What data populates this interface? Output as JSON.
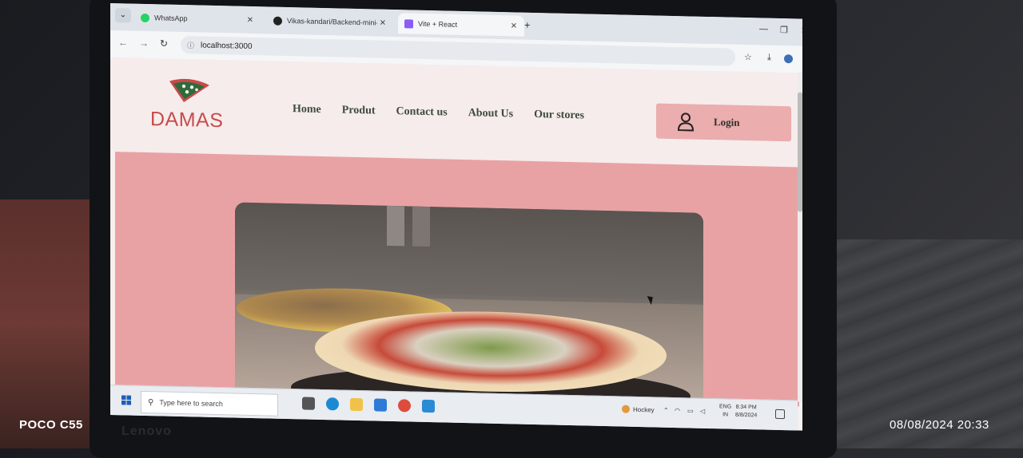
{
  "browser": {
    "tabs": [
      {
        "title": "WhatsApp",
        "favicon_color": "#25d366"
      },
      {
        "title": "Vikas-kandari/Backend-mini-pr",
        "favicon_color": "#222222"
      },
      {
        "title": "Vite + React",
        "favicon_color": "#8b5cf6"
      }
    ],
    "url": "localhost:3000"
  },
  "site": {
    "logo_text": "DAMAS",
    "nav": [
      "Home",
      "Produt",
      "Contact us",
      "About Us",
      "Our stores"
    ],
    "login_label": "Login",
    "accent": "#ebadad",
    "hero_bg": "#e9a2a4",
    "logo_color": "#c94a4a"
  },
  "taskbar": {
    "search_placeholder": "Type here to search",
    "weather": "Hockey",
    "lang_top": "ENG",
    "lang_bottom": "IN",
    "time": "8:34 PM",
    "date": "8/8/2024"
  },
  "device": {
    "model": "POCO C55",
    "laptop_brand": "Lenovo",
    "photo_timestamp": "08/08/2024  20:33"
  }
}
